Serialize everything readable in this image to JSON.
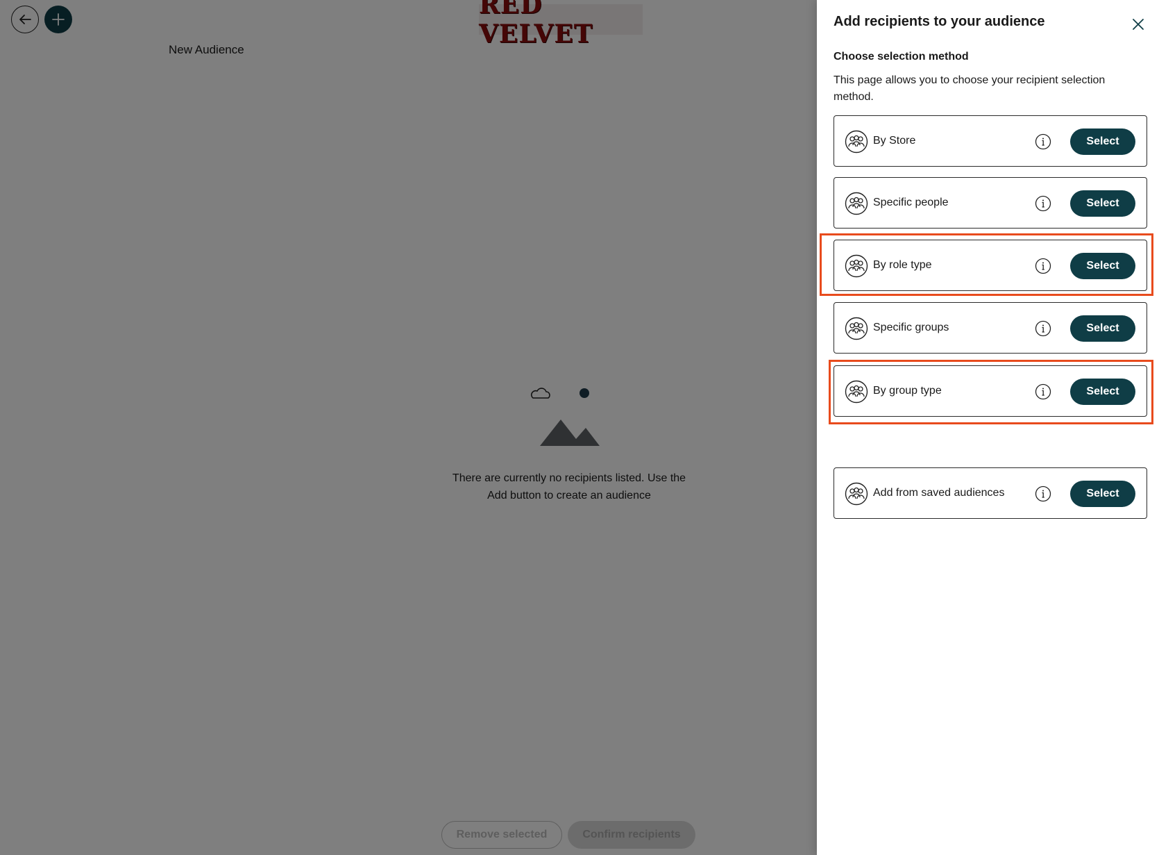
{
  "header": {
    "brand_logo_text": "RED VELVET",
    "back_icon": "arrow-left-icon",
    "add_icon": "plus-icon"
  },
  "audience": {
    "title": "New Audience",
    "empty_message": "There are currently no recipients listed. Use the Add button to create an audience"
  },
  "footer": {
    "remove_selected_label": "Remove selected",
    "confirm_recipients_label": "Confirm recipients"
  },
  "panel": {
    "title": "Add recipients to your audience",
    "section_heading": "Choose selection method",
    "section_description": "This page allows you to choose your recipient selection method.",
    "options": [
      {
        "label": "By Store",
        "select_label": "Select",
        "highlighted": false
      },
      {
        "label": "Specific people",
        "select_label": "Select",
        "highlighted": false
      },
      {
        "label": "By role type",
        "select_label": "Select",
        "highlighted": true
      },
      {
        "label": "Specific groups",
        "select_label": "Select",
        "highlighted": false
      },
      {
        "label": "By group type",
        "select_label": "Select",
        "highlighted": true
      },
      {
        "label": "Add from saved audiences",
        "select_label": "Select",
        "highlighted": false
      }
    ]
  },
  "colors": {
    "accent": "#0f3d46",
    "highlight": "#e84b1d",
    "brand": "#8b0d0d"
  }
}
